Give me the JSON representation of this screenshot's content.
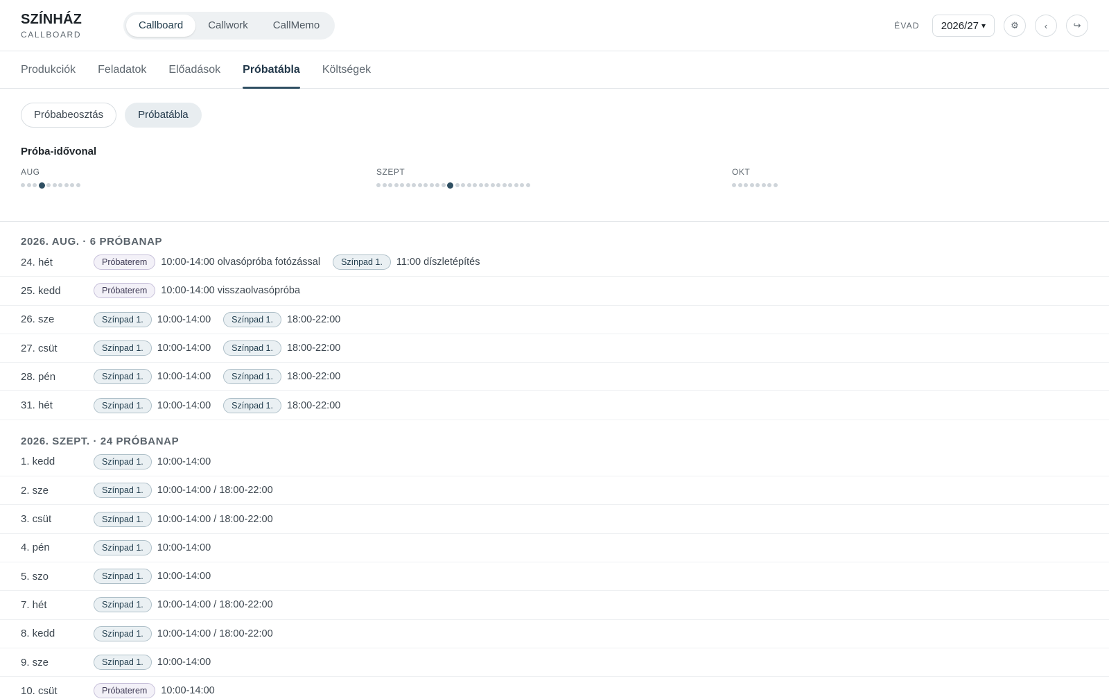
{
  "brand": {
    "title": "SZÍNHÁZ",
    "subtitle": "CALLBOARD"
  },
  "apps": [
    {
      "label": "Callboard",
      "active": true
    },
    {
      "label": "Callwork",
      "active": false
    },
    {
      "label": "CallMemo",
      "active": false
    }
  ],
  "season": {
    "label": "ÉVAD",
    "value": "2026/27",
    "caret": "▾"
  },
  "toolbar_icons": [
    {
      "name": "settings-icon",
      "glyph": "⚙"
    },
    {
      "name": "back-icon",
      "glyph": "‹"
    },
    {
      "name": "logout-icon",
      "glyph": "↪"
    }
  ],
  "tabs": [
    {
      "label": "Produkciók",
      "active": false
    },
    {
      "label": "Feladatok",
      "active": false
    },
    {
      "label": "Előadások",
      "active": false
    },
    {
      "label": "Próbatábla",
      "active": true
    },
    {
      "label": "Költségek",
      "active": false
    }
  ],
  "subtabs": [
    {
      "label": "Próbabeosztás",
      "active": false
    },
    {
      "label": "Próbatábla",
      "active": true
    }
  ],
  "timeline": {
    "title": "Próba-idővonal",
    "months": [
      {
        "label": "AUG",
        "dot_count": 10,
        "selected_index": 3
      },
      {
        "label": "SZEPT",
        "dot_count": 26,
        "selected_index": 12
      },
      {
        "label": "OKT",
        "dot_count": 8,
        "selected_index": null
      }
    ]
  },
  "groups": [
    {
      "title": "2026. AUG. · 6 PRÓBANAP",
      "rows": [
        {
          "date": "24. hét",
          "entries": [
            {
              "chip": "Próbaterem",
              "kind": "room",
              "text": "10:00-14:00 olvasópróba fotózással"
            },
            {
              "chip": "Színpad 1.",
              "kind": "stage",
              "text": "11:00 díszletépítés"
            }
          ]
        },
        {
          "date": "25. kedd",
          "entries": [
            {
              "chip": "Próbaterem",
              "kind": "room",
              "text": "10:00-14:00 visszaolvasópróba"
            }
          ]
        },
        {
          "date": "26. sze",
          "entries": [
            {
              "chip": "Színpad 1.",
              "kind": "stage",
              "text": "10:00-14:00"
            },
            {
              "chip": "Színpad 1.",
              "kind": "stage",
              "text": "18:00-22:00"
            }
          ]
        },
        {
          "date": "27. csüt",
          "entries": [
            {
              "chip": "Színpad 1.",
              "kind": "stage",
              "text": "10:00-14:00"
            },
            {
              "chip": "Színpad 1.",
              "kind": "stage",
              "text": "18:00-22:00"
            }
          ]
        },
        {
          "date": "28. pén",
          "entries": [
            {
              "chip": "Színpad 1.",
              "kind": "stage",
              "text": "10:00-14:00"
            },
            {
              "chip": "Színpad 1.",
              "kind": "stage",
              "text": "18:00-22:00"
            }
          ]
        },
        {
          "date": "31. hét",
          "entries": [
            {
              "chip": "Színpad 1.",
              "kind": "stage",
              "text": "10:00-14:00"
            },
            {
              "chip": "Színpad 1.",
              "kind": "stage",
              "text": "18:00-22:00"
            }
          ]
        }
      ]
    },
    {
      "title": "2026. SZEPT. · 24 PRÓBANAP",
      "rows": [
        {
          "date": "1. kedd",
          "entries": [
            {
              "chip": "Színpad 1.",
              "kind": "stage",
              "text": "10:00-14:00"
            }
          ]
        },
        {
          "date": "2. sze",
          "entries": [
            {
              "chip": "Színpad 1.",
              "kind": "stage",
              "text": "10:00-14:00 / 18:00-22:00"
            }
          ]
        },
        {
          "date": "3. csüt",
          "entries": [
            {
              "chip": "Színpad 1.",
              "kind": "stage",
              "text": "10:00-14:00 / 18:00-22:00"
            }
          ]
        },
        {
          "date": "4. pén",
          "entries": [
            {
              "chip": "Színpad 1.",
              "kind": "stage",
              "text": "10:00-14:00"
            }
          ]
        },
        {
          "date": "5. szo",
          "entries": [
            {
              "chip": "Színpad 1.",
              "kind": "stage",
              "text": "10:00-14:00"
            }
          ]
        },
        {
          "date": "7. hét",
          "entries": [
            {
              "chip": "Színpad 1.",
              "kind": "stage",
              "text": "10:00-14:00 / 18:00-22:00"
            }
          ]
        },
        {
          "date": "8. kedd",
          "entries": [
            {
              "chip": "Színpad 1.",
              "kind": "stage",
              "text": "10:00-14:00 / 18:00-22:00"
            }
          ]
        },
        {
          "date": "9. sze",
          "entries": [
            {
              "chip": "Színpad 1.",
              "kind": "stage",
              "text": "10:00-14:00"
            }
          ]
        },
        {
          "date": "10. csüt",
          "entries": [
            {
              "chip": "Próbaterem",
              "kind": "room",
              "text": "10:00-14:00"
            }
          ]
        }
      ]
    }
  ]
}
